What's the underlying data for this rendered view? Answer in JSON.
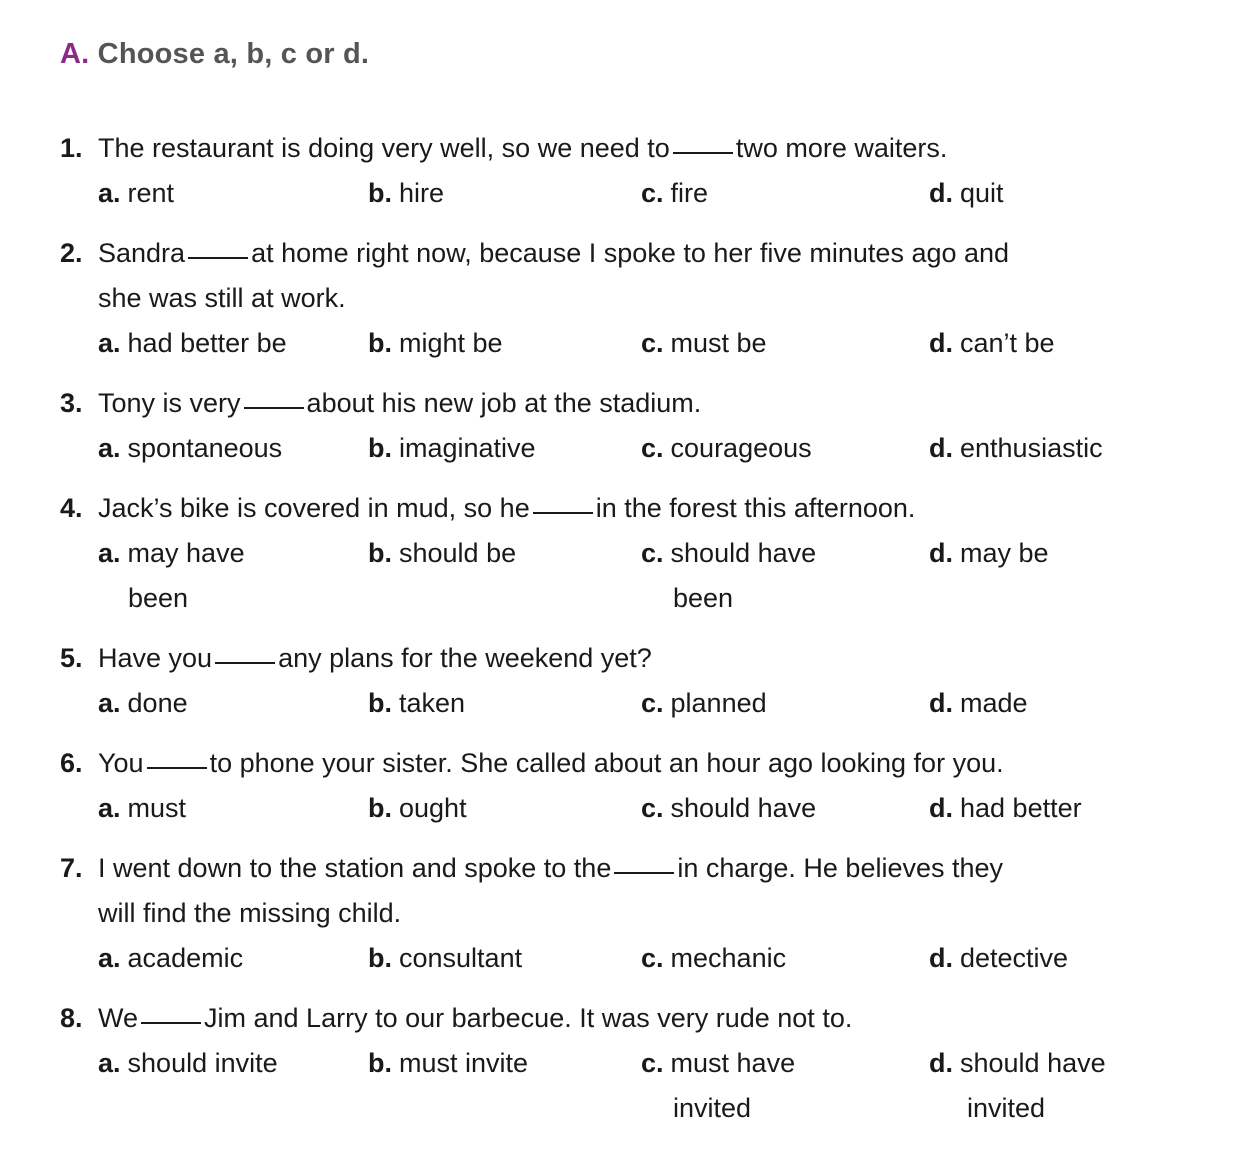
{
  "heading": {
    "letter": "A.",
    "text": "Choose a, b, c or d."
  },
  "questions": [
    {
      "number": "1.",
      "stem_before": "The restaurant is doing very well, so we need to",
      "stem_after": "two more waiters.",
      "stem_line2": "",
      "options": [
        {
          "letter": "a.",
          "text": "rent"
        },
        {
          "letter": "b.",
          "text": "hire"
        },
        {
          "letter": "c.",
          "text": "fire"
        },
        {
          "letter": "d.",
          "text": "quit"
        }
      ]
    },
    {
      "number": "2.",
      "stem_before": "Sandra",
      "stem_after": "at home right now, because I spoke to her five minutes ago and",
      "stem_line2": "she was still at work.",
      "options": [
        {
          "letter": "a.",
          "text": "had better be"
        },
        {
          "letter": "b.",
          "text": "might be"
        },
        {
          "letter": "c.",
          "text": "must be"
        },
        {
          "letter": "d.",
          "text": "can’t be"
        }
      ]
    },
    {
      "number": "3.",
      "stem_before": "Tony is very",
      "stem_after": "about his new job at the stadium.",
      "stem_line2": "",
      "options": [
        {
          "letter": "a.",
          "text": "spontaneous"
        },
        {
          "letter": "b.",
          "text": "imaginative"
        },
        {
          "letter": "c.",
          "text": "courageous"
        },
        {
          "letter": "d.",
          "text": "enthusiastic"
        }
      ]
    },
    {
      "number": "4.",
      "stem_before": "Jack’s bike is covered in mud, so he",
      "stem_after": "in the forest this afternoon.",
      "stem_line2": "",
      "options": [
        {
          "letter": "a.",
          "text": "may have",
          "text2": "been"
        },
        {
          "letter": "b.",
          "text": "should be"
        },
        {
          "letter": "c.",
          "text": "should have",
          "text2": "been"
        },
        {
          "letter": "d.",
          "text": "may be"
        }
      ]
    },
    {
      "number": "5.",
      "stem_before": "Have you",
      "stem_after": "any plans for the weekend yet?",
      "stem_line2": "",
      "options": [
        {
          "letter": "a.",
          "text": "done"
        },
        {
          "letter": "b.",
          "text": "taken"
        },
        {
          "letter": "c.",
          "text": "planned"
        },
        {
          "letter": "d.",
          "text": "made"
        }
      ]
    },
    {
      "number": "6.",
      "stem_before": "You",
      "stem_after": "to phone your sister. She called about an hour ago looking for you.",
      "stem_line2": "",
      "options": [
        {
          "letter": "a.",
          "text": "must"
        },
        {
          "letter": "b.",
          "text": "ought"
        },
        {
          "letter": "c.",
          "text": "should have"
        },
        {
          "letter": "d.",
          "text": "had better"
        }
      ]
    },
    {
      "number": "7.",
      "stem_before": "I went down to the station and spoke to the",
      "stem_after": "in charge. He believes they",
      "stem_line2": "will find the missing child.",
      "options": [
        {
          "letter": "a.",
          "text": "academic"
        },
        {
          "letter": "b.",
          "text": "consultant"
        },
        {
          "letter": "c.",
          "text": "mechanic"
        },
        {
          "letter": "d.",
          "text": "detective"
        }
      ]
    },
    {
      "number": "8.",
      "stem_before": "We",
      "stem_after": "Jim and Larry to our barbecue. It was very rude not to.",
      "stem_line2": "",
      "options": [
        {
          "letter": "a.",
          "text": "should invite"
        },
        {
          "letter": "b.",
          "text": "must invite"
        },
        {
          "letter": "c.",
          "text": "must have",
          "text2": "invited"
        },
        {
          "letter": "d.",
          "text": "should have",
          "text2": "invited"
        }
      ]
    }
  ]
}
